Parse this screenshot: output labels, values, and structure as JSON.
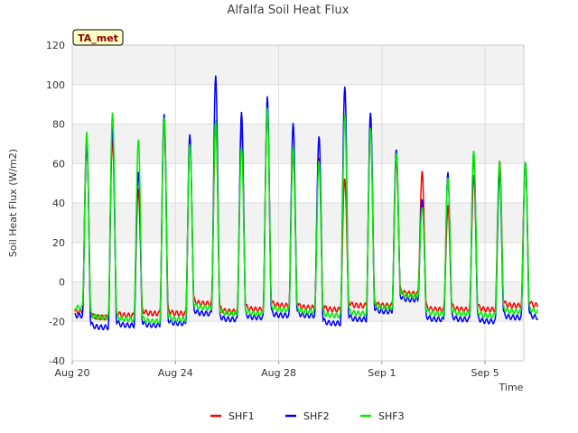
{
  "chart_data": {
    "type": "line",
    "title": "Alfalfa Soil Heat Flux",
    "badge": "TA_met",
    "xlabel": "Time",
    "ylabel": "Soil Heat Flux (W/m2)",
    "xlim": [
      0,
      17.5
    ],
    "ylim": [
      -40,
      120
    ],
    "yticks": [
      -40,
      -20,
      0,
      20,
      40,
      60,
      80,
      100,
      120
    ],
    "xticks": [
      {
        "value": 0,
        "label": "Aug 20"
      },
      {
        "value": 4,
        "label": "Aug 24"
      },
      {
        "value": 8,
        "label": "Aug 28"
      },
      {
        "value": 12,
        "label": "Sep 1"
      },
      {
        "value": 16,
        "label": "Sep 5"
      }
    ],
    "grid": true,
    "legend_position": "bottom",
    "series": [
      {
        "name": "SHF1",
        "color": "#ff0000",
        "daily_max": [
          72,
          73,
          47,
          80,
          72,
          80,
          78,
          89,
          66,
          64,
          53,
          80,
          62,
          55,
          38,
          54,
          62,
          60
        ],
        "daily_min": [
          -15,
          -18,
          -17,
          -16,
          -16,
          -11,
          -15,
          -14,
          -12,
          -13,
          -14,
          -12,
          -12,
          -6,
          -14,
          -14,
          -14,
          -12
        ]
      },
      {
        "name": "SHF2",
        "color": "#0000ff",
        "daily_max": [
          72,
          80,
          57,
          86,
          75,
          104,
          85,
          93,
          80,
          74,
          100,
          87,
          68,
          42,
          55,
          65,
          55,
          60
        ],
        "daily_min": [
          -17,
          -23,
          -22,
          -22,
          -21,
          -16,
          -19,
          -18,
          -17,
          -17,
          -21,
          -19,
          -15,
          -9,
          -19,
          -19,
          -20,
          -18
        ]
      },
      {
        "name": "SHF3",
        "color": "#00ee00",
        "daily_max": [
          75,
          85,
          72,
          84,
          71,
          83,
          69,
          88,
          68,
          60,
          84,
          78,
          66,
          39,
          54,
          67,
          61,
          60
        ],
        "daily_min": [
          -13,
          -18,
          -19,
          -20,
          -19,
          -13,
          -16,
          -16,
          -14,
          -15,
          -17,
          -16,
          -13,
          -7,
          -16,
          -16,
          -17,
          -15
        ]
      }
    ]
  }
}
